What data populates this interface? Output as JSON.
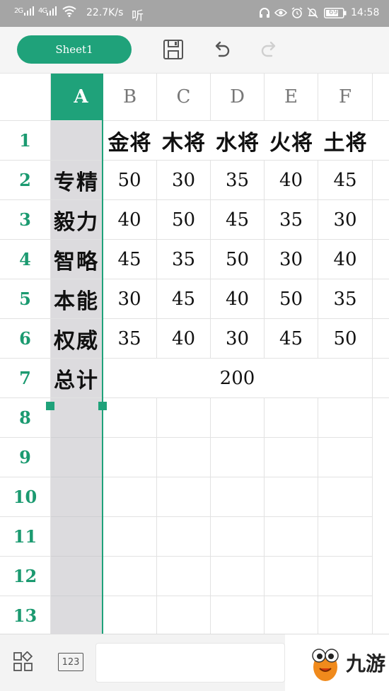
{
  "status_bar": {
    "signal_1": "2G",
    "signal_2": "4G",
    "speed": "22.7K/s",
    "app_tag": "听",
    "battery": "69",
    "time": "14:58"
  },
  "toolbar": {
    "sheet_tab": "Sheet1",
    "icons": [
      "save-icon",
      "undo-icon",
      "redo-icon"
    ]
  },
  "grid": {
    "columns": [
      "A",
      "B",
      "C",
      "D",
      "E",
      "F"
    ],
    "rows": [
      "1",
      "2",
      "3",
      "4",
      "5",
      "6",
      "7",
      "8",
      "9",
      "10",
      "11",
      "12",
      "13"
    ],
    "headers": [
      "金将",
      "木将",
      "水将",
      "火将",
      "土将"
    ],
    "data_rows": [
      {
        "label": "专精",
        "values": [
          "50",
          "30",
          "35",
          "40",
          "45"
        ]
      },
      {
        "label": "毅力",
        "values": [
          "40",
          "50",
          "45",
          "35",
          "30"
        ]
      },
      {
        "label": "智略",
        "values": [
          "45",
          "35",
          "50",
          "30",
          "40"
        ]
      },
      {
        "label": "本能",
        "values": [
          "30",
          "45",
          "40",
          "50",
          "35"
        ]
      },
      {
        "label": "权威",
        "values": [
          "35",
          "40",
          "30",
          "45",
          "50"
        ]
      }
    ],
    "total_label": "总计",
    "total_value": "200"
  },
  "bottom_bar": {
    "left_icons": [
      "apps-icon",
      "keyboard-123-icon"
    ],
    "keyboard_label": "123",
    "formula_value": "",
    "logo_text": "九游"
  },
  "colors": {
    "accent": "#1fa27a",
    "row_header": "#1b9a70",
    "selected_column": "#dcdbde"
  }
}
